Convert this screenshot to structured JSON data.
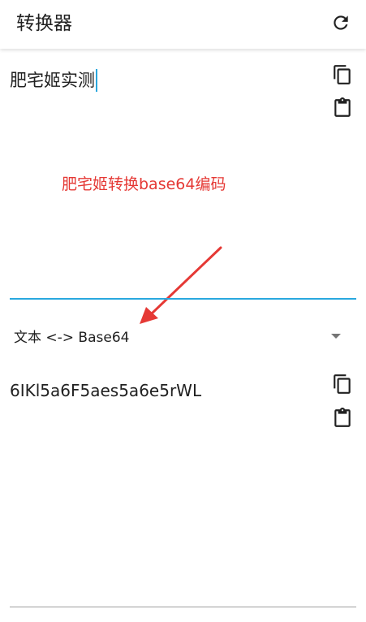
{
  "appbar": {
    "title": "转换器",
    "refresh_icon": "refresh-icon"
  },
  "input": {
    "value": "肥宅姬实测",
    "copy_icon": "copy-icon",
    "paste_icon": "paste-icon"
  },
  "annotation": {
    "text": "肥宅姬转换base64编码",
    "color": "#e53935"
  },
  "mode": {
    "selected": "文本 <-> Base64"
  },
  "output": {
    "value": "6IKl5a6F5aes5a6e5rWL",
    "copy_icon": "copy-icon",
    "paste_icon": "paste-icon"
  },
  "colors": {
    "accent": "#29a8df",
    "text": "#212121",
    "annotation": "#e53935"
  }
}
